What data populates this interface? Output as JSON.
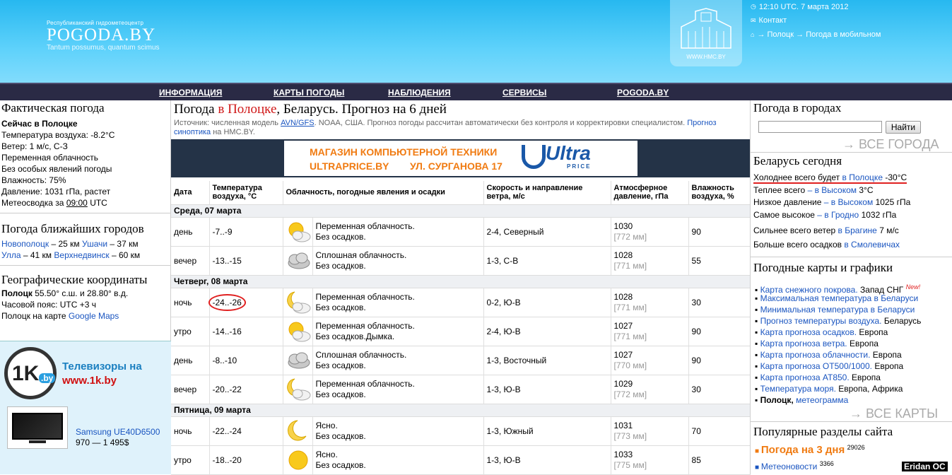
{
  "header": {
    "logo_sub": "Республиканский гидрометеоцентр",
    "logo_main": "POGODA.BY",
    "logo_motto": "Tantum possumus, quantum scimus",
    "hmc_label": "WWW.HMC.BY",
    "time": "12:10 UTC. 7 марта 2012",
    "contact": "Контакт",
    "breadcrumb_city": "Полоцк",
    "breadcrumb_mobile": "Погода в мобильном"
  },
  "nav": [
    "ИНФОРМАЦИЯ",
    "КАРТЫ ПОГОДЫ",
    "НАБЛЮДЕНИЯ",
    "СЕРВИСЫ",
    "POGODA.BY"
  ],
  "left": {
    "actual_title": "Фактическая погода",
    "now_prefix": "Сейчас",
    "now_city": "в Полоцке",
    "rows": [
      "Температура воздуха: -8.2°C",
      "Ветер: 1 м/с, С-З",
      "Переменная облачность",
      "Без особых явлений погоды",
      "Влажность: 75%",
      "Давление: 1031 гПа, растет"
    ],
    "synop_prefix": "Метеосводка за",
    "synop_time": "09:00",
    "synop_suffix": "UTC",
    "nearby_title": "Погода ближайших городов",
    "nearby": [
      {
        "city": "Новополоцк",
        "dist": "– 25 км"
      },
      {
        "city": "Ушачи",
        "dist": "– 37 км"
      },
      {
        "city": "Улла",
        "dist": "– 41 км"
      },
      {
        "city": "Верхнедвинск",
        "dist": "– 60 км"
      }
    ],
    "geo_title": "Географические координаты",
    "geo_city": "Полоцк",
    "geo_coords": "55.50° с.ш. и 28.80° в.д.",
    "geo_tz": "Часовой пояс: UTC +3 ч",
    "geo_map_prefix": "Полоцк на карте",
    "geo_map_link": "Google Maps",
    "ad_logo": "1K",
    "ad_logo_sub": ".by",
    "ad_line1": "Телевизоры на",
    "ad_line2": "www.1k.by",
    "ad_product": "Samsung UE40D6500",
    "ad_price": "970 — 1 495$"
  },
  "center": {
    "title_pre": "Погода",
    "title_city": "в Полоцке",
    "title_post": ", Беларусь. Прогноз на 6 дней",
    "source_pre": "Источник: численная модель",
    "source_link": "AVN/GFS",
    "source_post": ". NOAA, США. Прогноз погоды рассчитан автоматически без контроля и корректировки специалистом.",
    "synoptic_link": "Прогноз синоптика",
    "synoptic_post": "на HMC.BY.",
    "banner_line1": "МАГАЗИН КОМПЬЮТЕРНОЙ ТЕХНИКИ",
    "banner_line2": "ULTRAPRICE.BY",
    "banner_addr": "УЛ. СУРГАНОВА 17",
    "banner_brand": "Ultra",
    "banner_brand_sub": "PRICE",
    "headers": [
      "Дата",
      "Температура воздуха, °C",
      "Облачность, погодные явления и осадки",
      "Скорость и направление ветра, м/с",
      "Атмосферное давление, гПа",
      "Влажность воздуха, %"
    ],
    "days": [
      {
        "label": "Среда, 07 марта",
        "rows": [
          {
            "time": "день",
            "temp": "-7..-9",
            "icon": "partly-cloudy-sun-icon",
            "cond1": "Переменная облачность.",
            "cond2": "Без осадков.",
            "wind": "2-4, Северный",
            "p1": "1030",
            "p2": "[772 мм]",
            "hum": "90"
          },
          {
            "time": "вечер",
            "temp": "-13..-15",
            "icon": "overcast-cloud-icon",
            "cond1": "Сплошная облачность.",
            "cond2": "Без осадков.",
            "wind": "1-3, С-В",
            "p1": "1028",
            "p2": "[771 мм]",
            "hum": "55"
          }
        ]
      },
      {
        "label": "Четверг, 08 марта",
        "rows": [
          {
            "time": "ночь",
            "temp": "-24..-26",
            "icon": "partly-cloudy-moon-icon",
            "cond1": "Переменная облачность.",
            "cond2": "Без осадков.",
            "wind": "0-2, Ю-В",
            "p1": "1028",
            "p2": "[771 мм]",
            "hum": "30",
            "circle": true
          },
          {
            "time": "утро",
            "temp": "-14..-16",
            "icon": "partly-cloudy-sun-icon",
            "cond1": "Переменная облачность.",
            "cond2": "Без осадков.Дымка.",
            "wind": "2-4, Ю-В",
            "p1": "1027",
            "p2": "[771 мм]",
            "hum": "90"
          },
          {
            "time": "день",
            "temp": "-8..-10",
            "icon": "overcast-cloud-icon",
            "cond1": "Сплошная облачность.",
            "cond2": "Без осадков.",
            "wind": "1-3, Восточный",
            "p1": "1027",
            "p2": "[770 мм]",
            "hum": "90"
          },
          {
            "time": "вечер",
            "temp": "-20..-22",
            "icon": "partly-cloudy-moon-icon",
            "cond1": "Переменная облачность.",
            "cond2": "Без осадков.",
            "wind": "1-3, Ю-В",
            "p1": "1029",
            "p2": "[772 мм]",
            "hum": "30"
          }
        ]
      },
      {
        "label": "Пятница, 09 марта",
        "rows": [
          {
            "time": "ночь",
            "temp": "-22..-24",
            "icon": "moon-icon",
            "cond1": "Ясно.",
            "cond2": "Без осадков.",
            "wind": "1-3, Южный",
            "p1": "1031",
            "p2": "[773 мм]",
            "hum": "70"
          },
          {
            "time": "утро",
            "temp": "-18..-20",
            "icon": "sun-icon",
            "cond1": "Ясно.",
            "cond2": "Без осадков.",
            "wind": "1-3, Ю-В",
            "p1": "1033",
            "p2": "[775 мм]",
            "hum": "85"
          }
        ]
      }
    ]
  },
  "right": {
    "cities_title": "Погода в городах",
    "search_value": "",
    "search_button": "Найти",
    "all_cities": "→ ВСЕ ГОРОДА",
    "today_title": "Беларусь сегодня",
    "today": [
      {
        "pre": "Холоднее всего будет",
        "link": "в Полоцке",
        "val": "-30°C"
      },
      {
        "pre": "Теплее всего",
        "link": "– в Высоком",
        "val": "3°C"
      },
      {
        "pre": "Низкое давление",
        "link": "– в Высоком",
        "val": "1025 гПа"
      },
      {
        "pre": "Самое высокое",
        "link": "– в Гродно",
        "val": "1032 гПа"
      },
      {
        "pre": "Сильнее всего ветер",
        "link": "в Брагине",
        "val": "7 м/с"
      },
      {
        "pre": "Больше всего осадков",
        "link": "в Смолевичах",
        "val": ""
      }
    ],
    "maps_title": "Погодные карты и графики",
    "maps": [
      {
        "link": "Карта снежного покрова.",
        "rest": "Запад СНГ",
        "new": "New!"
      },
      {
        "link": "Максимальная температура в Беларуси",
        "rest": ""
      },
      {
        "link": "Минимальная температура в Беларуси",
        "rest": ""
      },
      {
        "link": "Прогноз температуры воздуха.",
        "rest": "Беларусь"
      },
      {
        "link": "Карта прогноза осадков.",
        "rest": "Европа"
      },
      {
        "link": "Карта прогноза ветра.",
        "rest": "Европа"
      },
      {
        "link": "Карта прогноза облачности.",
        "rest": "Европа"
      },
      {
        "link": "Карта прогноза ОТ500/1000.",
        "rest": "Европа"
      },
      {
        "link": "Карта прогноза АТ850.",
        "rest": "Европа"
      },
      {
        "link": "Температура моря.",
        "rest": "Европа, Африка"
      },
      {
        "bold": "Полоцк,",
        "link": "метеограмма",
        "rest": ""
      }
    ],
    "all_maps": "→ ВСЕ КАРТЫ",
    "popular_title": "Популярные разделы сайта",
    "popular": [
      {
        "link": "Погода на 3 дня",
        "count": "29026"
      },
      {
        "link": "Метеоновости",
        "count": "3366"
      }
    ],
    "watermark": "Eridan OC"
  }
}
